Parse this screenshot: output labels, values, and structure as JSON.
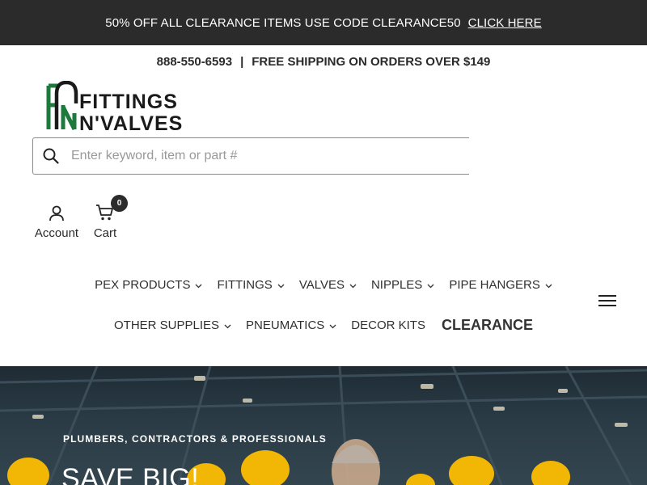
{
  "announcement": {
    "text": "50% OFF ALL CLEARANCE ITEMS USE CODE CLEARANCE50",
    "link": "CLICK HERE"
  },
  "infobar": {
    "phone": "888-550-6593",
    "separator": "|",
    "shipping": "FREE SHIPPING ON ORDERS OVER $149"
  },
  "logo": {
    "line1": "FITTINGS",
    "line2": "N'VALVES",
    "brand_colors": {
      "green": "#1e7a3c",
      "dark": "#1a1a1a"
    }
  },
  "search": {
    "placeholder": "Enter keyword, item or part #",
    "value": ""
  },
  "account": {
    "label": "Account",
    "icon": "user-icon"
  },
  "cart": {
    "label": "Cart",
    "count": "0",
    "icon": "cart-icon"
  },
  "nav": {
    "row1": [
      {
        "label": "PEX PRODUCTS",
        "has_dropdown": true
      },
      {
        "label": "FITTINGS",
        "has_dropdown": true
      },
      {
        "label": "VALVES",
        "has_dropdown": true
      },
      {
        "label": "NIPPLES",
        "has_dropdown": true
      },
      {
        "label": "PIPE HANGERS",
        "has_dropdown": true
      }
    ],
    "row2": [
      {
        "label": "OTHER SUPPLIES",
        "has_dropdown": true
      },
      {
        "label": "PNEUMATICS",
        "has_dropdown": true
      },
      {
        "label": "DECOR KITS",
        "has_dropdown": false
      },
      {
        "label": "CLEARANCE",
        "has_dropdown": false
      }
    ],
    "menu_icon": "hamburger-icon"
  },
  "hero": {
    "eyebrow": "PLUMBERS, CONTRACTORS & PROFESSIONALS",
    "headline": "SAVE BIG!"
  },
  "colors": {
    "announcement_bg": "#2b2b2b",
    "text": "#2a2a2a",
    "hard_hat": "#f2b705"
  }
}
